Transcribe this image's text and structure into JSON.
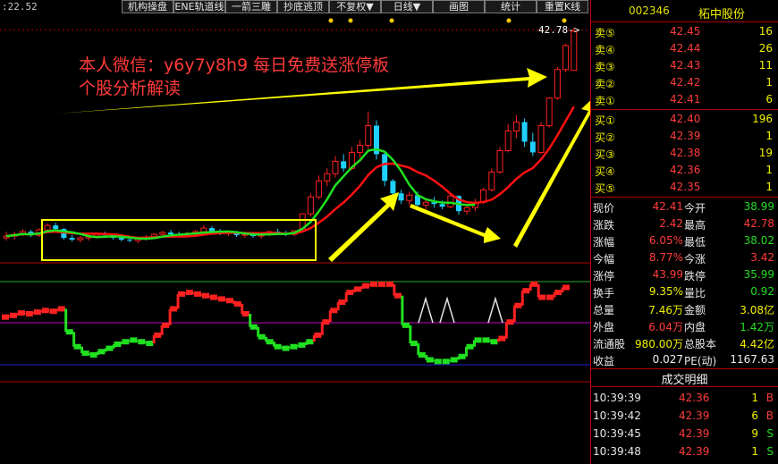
{
  "toolbar": {
    "readout": ":22.52",
    "buttons": [
      "机构操盘",
      "ENE轨道线",
      "一箭三雕",
      "抄底逃顶",
      "不复权▼",
      "日线▼",
      "画图",
      "统计",
      "重置K线"
    ]
  },
  "chart": {
    "price_tag": "42.78->",
    "promo_line1": "本人微信：y6y7y8h9 每日免费送涨停板",
    "promo_line2": "个股分析解读",
    "colors": {
      "up": "#ff2020",
      "down": "#20d0ff",
      "ma_red": "#ff1010",
      "ma_green": "#20e020",
      "arrow": "#ffff00",
      "box": "#ffff00"
    },
    "candles": [
      {
        "o": 19.2,
        "h": 19.9,
        "l": 18.9,
        "c": 19.4
      },
      {
        "o": 19.4,
        "h": 19.9,
        "l": 19.0,
        "c": 19.6
      },
      {
        "o": 19.6,
        "h": 20.2,
        "l": 19.4,
        "c": 19.9
      },
      {
        "o": 19.9,
        "h": 20.1,
        "l": 19.3,
        "c": 19.5
      },
      {
        "o": 19.5,
        "h": 20.3,
        "l": 19.3,
        "c": 20.1
      },
      {
        "o": 20.1,
        "h": 20.8,
        "l": 19.9,
        "c": 20.6
      },
      {
        "o": 20.6,
        "h": 20.9,
        "l": 20.0,
        "c": 20.2
      },
      {
        "o": 20.2,
        "h": 20.3,
        "l": 19.0,
        "c": 19.2
      },
      {
        "o": 19.2,
        "h": 19.5,
        "l": 18.8,
        "c": 19.0
      },
      {
        "o": 19.0,
        "h": 19.4,
        "l": 18.7,
        "c": 19.2
      },
      {
        "o": 19.2,
        "h": 19.6,
        "l": 18.9,
        "c": 19.4
      },
      {
        "o": 19.4,
        "h": 19.8,
        "l": 19.2,
        "c": 19.6
      },
      {
        "o": 19.6,
        "h": 19.9,
        "l": 19.3,
        "c": 19.5
      },
      {
        "o": 19.5,
        "h": 19.7,
        "l": 19.0,
        "c": 19.2
      },
      {
        "o": 19.2,
        "h": 19.5,
        "l": 18.8,
        "c": 19.0
      },
      {
        "o": 19.0,
        "h": 19.4,
        "l": 18.7,
        "c": 18.9
      },
      {
        "o": 18.9,
        "h": 19.3,
        "l": 18.6,
        "c": 19.1
      },
      {
        "o": 19.1,
        "h": 19.5,
        "l": 18.9,
        "c": 19.3
      },
      {
        "o": 19.3,
        "h": 19.7,
        "l": 19.1,
        "c": 19.6
      },
      {
        "o": 19.6,
        "h": 20.0,
        "l": 19.4,
        "c": 19.8
      },
      {
        "o": 19.8,
        "h": 20.1,
        "l": 19.5,
        "c": 19.6
      },
      {
        "o": 19.6,
        "h": 19.9,
        "l": 19.3,
        "c": 19.5
      },
      {
        "o": 19.5,
        "h": 19.9,
        "l": 19.3,
        "c": 19.7
      },
      {
        "o": 19.7,
        "h": 20.1,
        "l": 19.5,
        "c": 19.9
      },
      {
        "o": 19.9,
        "h": 20.6,
        "l": 19.7,
        "c": 20.3
      },
      {
        "o": 20.3,
        "h": 20.5,
        "l": 19.8,
        "c": 19.9
      },
      {
        "o": 19.9,
        "h": 20.2,
        "l": 19.5,
        "c": 19.7
      },
      {
        "o": 19.7,
        "h": 20.0,
        "l": 19.4,
        "c": 19.8
      },
      {
        "o": 19.8,
        "h": 20.0,
        "l": 19.3,
        "c": 19.5
      },
      {
        "o": 19.5,
        "h": 19.8,
        "l": 19.2,
        "c": 19.6
      },
      {
        "o": 19.6,
        "h": 19.9,
        "l": 19.2,
        "c": 19.4
      },
      {
        "o": 19.4,
        "h": 19.7,
        "l": 19.1,
        "c": 19.6
      },
      {
        "o": 19.6,
        "h": 20.0,
        "l": 19.4,
        "c": 19.9
      },
      {
        "o": 19.9,
        "h": 20.2,
        "l": 19.5,
        "c": 19.7
      },
      {
        "o": 19.7,
        "h": 20.0,
        "l": 19.4,
        "c": 19.6
      },
      {
        "o": 19.6,
        "h": 20.1,
        "l": 19.4,
        "c": 20.0
      },
      {
        "o": 20.0,
        "h": 22.0,
        "l": 19.9,
        "c": 21.9
      },
      {
        "o": 21.9,
        "h": 24.2,
        "l": 21.6,
        "c": 23.8
      },
      {
        "o": 23.8,
        "h": 26.2,
        "l": 23.5,
        "c": 25.6
      },
      {
        "o": 25.6,
        "h": 27.0,
        "l": 25.0,
        "c": 26.4
      },
      {
        "o": 26.4,
        "h": 28.4,
        "l": 26.0,
        "c": 27.8
      },
      {
        "o": 27.8,
        "h": 28.6,
        "l": 26.6,
        "c": 27.0
      },
      {
        "o": 27.0,
        "h": 29.4,
        "l": 26.8,
        "c": 28.8
      },
      {
        "o": 28.8,
        "h": 30.2,
        "l": 28.2,
        "c": 29.6
      },
      {
        "o": 29.6,
        "h": 33.4,
        "l": 29.2,
        "c": 31.8
      },
      {
        "o": 31.8,
        "h": 32.4,
        "l": 28.0,
        "c": 28.6
      },
      {
        "o": 28.6,
        "h": 28.8,
        "l": 25.0,
        "c": 25.6
      },
      {
        "o": 25.6,
        "h": 25.8,
        "l": 23.6,
        "c": 24.2
      },
      {
        "o": 24.2,
        "h": 24.6,
        "l": 23.0,
        "c": 23.4
      },
      {
        "o": 23.4,
        "h": 24.4,
        "l": 22.8,
        "c": 24.0
      },
      {
        "o": 24.0,
        "h": 24.4,
        "l": 22.6,
        "c": 22.9
      },
      {
        "o": 22.9,
        "h": 23.6,
        "l": 22.4,
        "c": 23.2
      },
      {
        "o": 23.2,
        "h": 23.8,
        "l": 22.6,
        "c": 23.0
      },
      {
        "o": 23.0,
        "h": 23.4,
        "l": 22.4,
        "c": 22.7
      },
      {
        "o": 22.7,
        "h": 24.2,
        "l": 22.5,
        "c": 23.9
      },
      {
        "o": 23.9,
        "h": 24.0,
        "l": 21.8,
        "c": 22.2
      },
      {
        "o": 22.2,
        "h": 22.8,
        "l": 21.8,
        "c": 22.6
      },
      {
        "o": 22.6,
        "h": 23.6,
        "l": 22.2,
        "c": 23.2
      },
      {
        "o": 23.2,
        "h": 24.8,
        "l": 23.0,
        "c": 24.6
      },
      {
        "o": 24.6,
        "h": 27.0,
        "l": 24.4,
        "c": 26.6
      },
      {
        "o": 26.6,
        "h": 29.4,
        "l": 26.4,
        "c": 29.0
      },
      {
        "o": 29.0,
        "h": 32.0,
        "l": 28.8,
        "c": 31.2
      },
      {
        "o": 31.2,
        "h": 33.0,
        "l": 30.4,
        "c": 32.2
      },
      {
        "o": 32.2,
        "h": 32.6,
        "l": 29.4,
        "c": 30.0
      },
      {
        "o": 30.0,
        "h": 31.0,
        "l": 28.4,
        "c": 28.8
      },
      {
        "o": 28.8,
        "h": 32.2,
        "l": 28.6,
        "c": 31.8
      },
      {
        "o": 31.8,
        "h": 35.0,
        "l": 31.6,
        "c": 34.9
      },
      {
        "o": 34.9,
        "h": 38.4,
        "l": 34.7,
        "c": 38.1
      },
      {
        "o": 38.1,
        "h": 41.0,
        "l": 37.8,
        "c": 40.8
      },
      {
        "o": 38.0,
        "h": 42.78,
        "l": 38.02,
        "c": 42.41
      }
    ],
    "indicator": [
      {
        "v": 58,
        "c": "r"
      },
      {
        "v": 60,
        "c": "r"
      },
      {
        "v": 63,
        "c": "r"
      },
      {
        "v": 62,
        "c": "r"
      },
      {
        "v": 64,
        "c": "r"
      },
      {
        "v": 66,
        "c": "r"
      },
      {
        "v": 65,
        "c": "r"
      },
      {
        "v": 68,
        "c": "r"
      },
      {
        "v": 40,
        "c": "g"
      },
      {
        "v": 22,
        "c": "g"
      },
      {
        "v": 14,
        "c": "g"
      },
      {
        "v": 12,
        "c": "g"
      },
      {
        "v": 16,
        "c": "g"
      },
      {
        "v": 20,
        "c": "g"
      },
      {
        "v": 25,
        "c": "g"
      },
      {
        "v": 28,
        "c": "g"
      },
      {
        "v": 30,
        "c": "g"
      },
      {
        "v": 28,
        "c": "g"
      },
      {
        "v": 26,
        "c": "g"
      },
      {
        "v": 36,
        "c": "r"
      },
      {
        "v": 48,
        "c": "r"
      },
      {
        "v": 68,
        "c": "r"
      },
      {
        "v": 86,
        "c": "r"
      },
      {
        "v": 88,
        "c": "r"
      },
      {
        "v": 86,
        "c": "r"
      },
      {
        "v": 84,
        "c": "r"
      },
      {
        "v": 82,
        "c": "r"
      },
      {
        "v": 80,
        "c": "r"
      },
      {
        "v": 78,
        "c": "r"
      },
      {
        "v": 74,
        "c": "r"
      },
      {
        "v": 62,
        "c": "r"
      },
      {
        "v": 46,
        "c": "g"
      },
      {
        "v": 34,
        "c": "g"
      },
      {
        "v": 28,
        "c": "g"
      },
      {
        "v": 22,
        "c": "g"
      },
      {
        "v": 20,
        "c": "g"
      },
      {
        "v": 22,
        "c": "g"
      },
      {
        "v": 24,
        "c": "g"
      },
      {
        "v": 28,
        "c": "g"
      },
      {
        "v": 36,
        "c": "r"
      },
      {
        "v": 52,
        "c": "r"
      },
      {
        "v": 66,
        "c": "r"
      },
      {
        "v": 76,
        "c": "r"
      },
      {
        "v": 88,
        "c": "r"
      },
      {
        "v": 92,
        "c": "r"
      },
      {
        "v": 96,
        "c": "r"
      },
      {
        "v": 98,
        "c": "r"
      },
      {
        "v": 98,
        "c": "r"
      },
      {
        "v": 98,
        "c": "r"
      },
      {
        "v": 84,
        "c": "r"
      },
      {
        "v": 48,
        "c": "g"
      },
      {
        "v": 26,
        "c": "g"
      },
      {
        "v": 12,
        "c": "g"
      },
      {
        "v": 6,
        "c": "g"
      },
      {
        "v": 4,
        "c": "g"
      },
      {
        "v": 4,
        "c": "g"
      },
      {
        "v": 6,
        "c": "g"
      },
      {
        "v": 10,
        "c": "g"
      },
      {
        "v": 22,
        "c": "g"
      },
      {
        "v": 30,
        "c": "g"
      },
      {
        "v": 30,
        "c": "g"
      },
      {
        "v": 28,
        "c": "g"
      },
      {
        "v": 32,
        "c": "r"
      },
      {
        "v": 52,
        "c": "r"
      },
      {
        "v": 72,
        "c": "r"
      },
      {
        "v": 90,
        "c": "r"
      },
      {
        "v": 98,
        "c": "r"
      },
      {
        "v": 82,
        "c": "r"
      },
      {
        "v": 82,
        "c": "r"
      },
      {
        "v": 88,
        "c": "r"
      },
      {
        "v": 94,
        "c": "r"
      }
    ]
  },
  "quote": {
    "code": "002346",
    "name": "柘中股份",
    "asks": [
      {
        "label": "卖⑤",
        "price": "42.45",
        "vol": "16"
      },
      {
        "label": "卖④",
        "price": "42.44",
        "vol": "26"
      },
      {
        "label": "卖③",
        "price": "42.43",
        "vol": "11"
      },
      {
        "label": "卖②",
        "price": "42.42",
        "vol": "1"
      },
      {
        "label": "卖①",
        "price": "42.41",
        "vol": "6"
      }
    ],
    "bids": [
      {
        "label": "买①",
        "price": "42.40",
        "vol": "196"
      },
      {
        "label": "买②",
        "price": "42.39",
        "vol": "1"
      },
      {
        "label": "买③",
        "price": "42.38",
        "vol": "19"
      },
      {
        "label": "买④",
        "price": "42.36",
        "vol": "1"
      },
      {
        "label": "买⑤",
        "price": "42.35",
        "vol": "1"
      }
    ],
    "stats": [
      {
        "l1": "现价",
        "v1": "42.41",
        "c1": "red",
        "l2": "今开",
        "v2": "38.99",
        "c2": "green"
      },
      {
        "l1": "涨跌",
        "v1": "2.42",
        "c1": "red",
        "l2": "最高",
        "v2": "42.78",
        "c2": "red"
      },
      {
        "l1": "涨幅",
        "v1": "6.05%",
        "c1": "red",
        "l2": "最低",
        "v2": "38.02",
        "c2": "green"
      },
      {
        "l1": "今幅",
        "v1": "8.77%",
        "c1": "red",
        "l2": "今涨",
        "v2": "3.42",
        "c2": "red"
      },
      {
        "l1": "涨停",
        "v1": "43.99",
        "c1": "red",
        "l2": "跌停",
        "v2": "35.99",
        "c2": "green"
      },
      {
        "l1": "换手",
        "v1": "9.35%",
        "c1": "yellow",
        "l2": "量比",
        "v2": "0.92",
        "c2": "green"
      },
      {
        "l1": "总量",
        "v1": "7.46万",
        "c1": "yellow",
        "l2": "金额",
        "v2": "3.08亿",
        "c2": "yellow"
      },
      {
        "l1": "外盘",
        "v1": "6.04万",
        "c1": "red",
        "l2": "内盘",
        "v2": "1.42万",
        "c2": "green"
      },
      {
        "l1": "流通股",
        "v1": "980.00万",
        "c1": "yellow",
        "l2": "总股本",
        "v2": "4.42亿",
        "c2": "yellow"
      },
      {
        "l1": "收益",
        "v1": "0.027",
        "c1": "white",
        "l2": "PE(动)",
        "v2": "1167.63",
        "c2": "white"
      }
    ],
    "trades_title": "成交明细",
    "trades": [
      {
        "time": "10:39:39",
        "price": "42.36",
        "vol": "1",
        "side": "B"
      },
      {
        "time": "10:39:42",
        "price": "42.39",
        "vol": "6",
        "side": "B"
      },
      {
        "time": "10:39:45",
        "price": "42.39",
        "vol": "9",
        "side": "S"
      },
      {
        "time": "10:39:48",
        "price": "42.39",
        "vol": "1",
        "side": "S"
      }
    ]
  }
}
